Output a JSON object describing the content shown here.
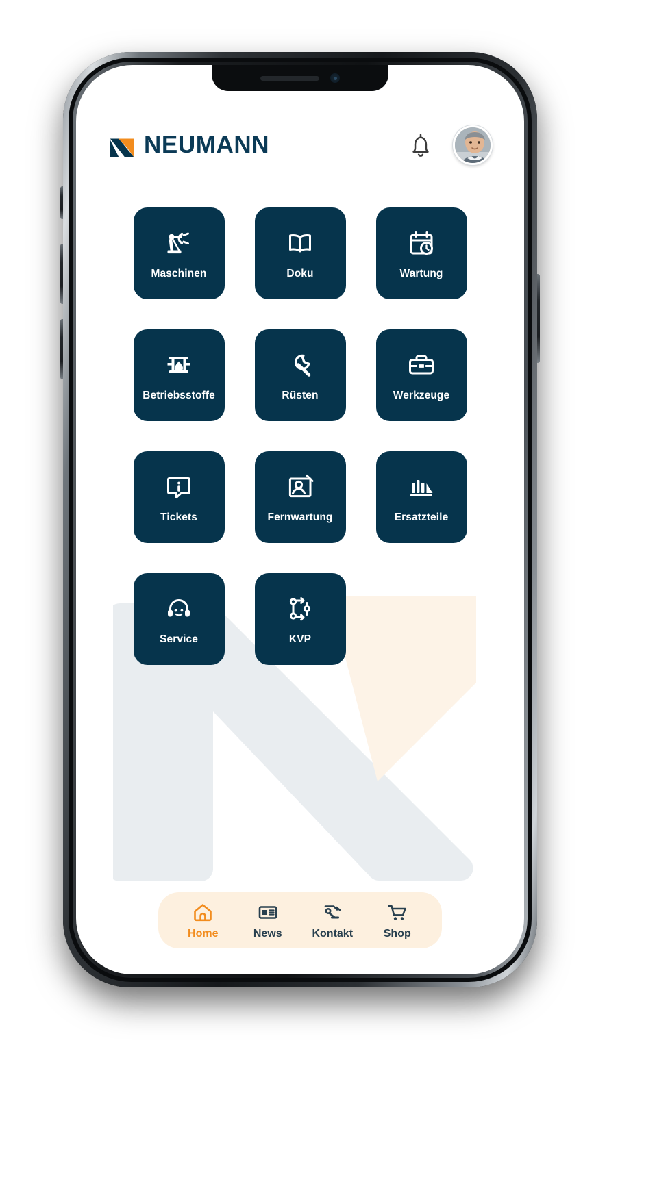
{
  "app": {
    "brand_navy": "#06344c",
    "brand_orange": "#f28c1e",
    "nav_pill_bg": "#fdf0df",
    "tile_bg": "#06344c"
  },
  "header": {
    "logo_text": "NEUMANN",
    "logo_mark_name": "neumann-n-logo",
    "notification_icon": "bell-icon",
    "avatar_name": "user-avatar"
  },
  "grid": {
    "tiles": [
      {
        "label": "Maschinen",
        "icon": "robot-arm-icon"
      },
      {
        "label": "Doku",
        "icon": "open-book-icon"
      },
      {
        "label": "Wartung",
        "icon": "calendar-clock-icon"
      },
      {
        "label": "Betriebsstoffe",
        "icon": "oil-barrel-drop-icon"
      },
      {
        "label": "Rüsten",
        "icon": "wrench-icon"
      },
      {
        "label": "Werkzeuge",
        "icon": "toolbox-icon"
      },
      {
        "label": "Tickets",
        "icon": "info-chat-icon"
      },
      {
        "label": "Fernwartung",
        "icon": "remote-support-icon"
      },
      {
        "label": "Ersatzteile",
        "icon": "spare-parts-icon"
      },
      {
        "label": "Service",
        "icon": "headset-support-icon"
      },
      {
        "label": "KVP",
        "icon": "process-improvement-icon"
      }
    ]
  },
  "bottom_nav": {
    "items": [
      {
        "label": "Home",
        "icon": "home-icon",
        "active": true
      },
      {
        "label": "News",
        "icon": "news-icon",
        "active": false
      },
      {
        "label": "Kontakt",
        "icon": "contact-icon",
        "active": false
      },
      {
        "label": "Shop",
        "icon": "cart-icon",
        "active": false
      }
    ]
  }
}
